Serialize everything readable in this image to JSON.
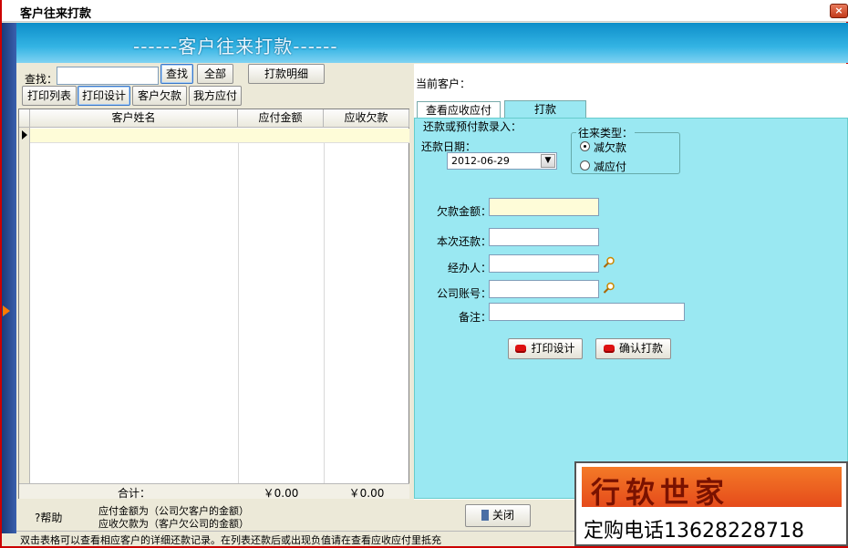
{
  "window": {
    "title": "客户往来打款",
    "close_label": "×"
  },
  "banner": {
    "title": "------客户往来打款------"
  },
  "toolbar": {
    "search_label": "查找：",
    "search_value": "",
    "find_button": "查找",
    "all_button": "全部",
    "payment_detail_button": "打款明细",
    "print_list_button": "打印列表",
    "print_design_button": "打印设计",
    "customer_debt_button": "客户欠款",
    "our_payable_button": "我方应付"
  },
  "grid": {
    "columns": [
      "客户姓名",
      "应付金额",
      "应收欠款"
    ],
    "total_label": "合计：",
    "total_payable": "￥0.00",
    "total_receivable": "￥0.00"
  },
  "right": {
    "current_customer_label": "当前客户：",
    "tabs": [
      "查看应收应付",
      "打款"
    ],
    "entry_group_label": "还款或预付款录入：",
    "repay_date_label": "还款日期：",
    "repay_date_value": "2012-06-29",
    "type_group_label": "往来类型：",
    "type_options": [
      "减欠款",
      "减应付"
    ],
    "debt_amount_label": "欠款金额：",
    "this_repay_label": "本次还款：",
    "handler_label": "经办人：",
    "company_account_label": "公司账号：",
    "note_label": "备注：",
    "print_design_button": "打印设计",
    "confirm_payment_button": "确认打款"
  },
  "bottom": {
    "help_label": "?帮助",
    "note_line1": "应付金额为（公司欠客户的金额）",
    "note_line2": "应收欠款为（客户欠公司的金额）",
    "close_button": "关闭",
    "status_text": "双击表格可以查看相应客户的详细还款记录。在列表还款后或出现负值请在查看应收应付里抵充"
  },
  "ad": {
    "brand": "行软世家",
    "phone": "定购电话13628228718"
  },
  "colors": {
    "banner": "#34b4e4",
    "panel": "#9ae8f2",
    "highlight_row": "#fefcd8",
    "ad_bg": "#e54b1b"
  }
}
